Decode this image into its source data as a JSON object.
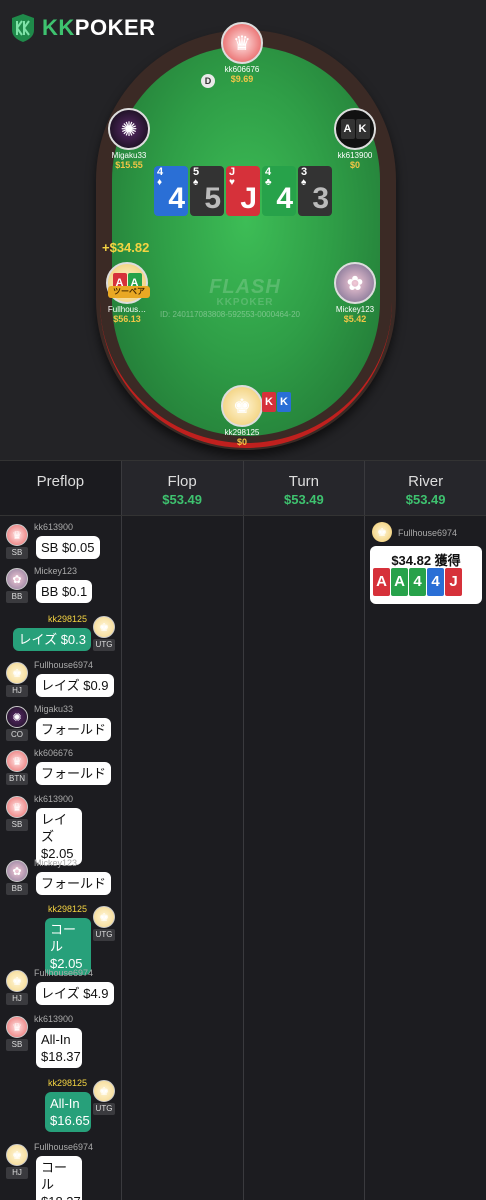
{
  "app": {
    "logo_text": "KKPOKER",
    "logo_kk": "KK",
    "logo_rest": "POKER"
  },
  "colors": {
    "felt": "#2f9e47",
    "accent_green": "#3ec26f",
    "stack_gold": "#f2c646",
    "raise_bubble": "#27a07a"
  },
  "table": {
    "watermark_main": "FLASH",
    "watermark_sub": "KKPOKER",
    "hand_id": "ID: 240117083808-592553-0000464-20",
    "dealer_button": "D",
    "winner_amount": "+$34.82",
    "winner_hand_badge": "ツーペア",
    "players": {
      "top": {
        "name": "kk606676",
        "stack": "$9.69"
      },
      "migaku": {
        "name": "Migaku33",
        "stack": "$15.55"
      },
      "kk613900": {
        "name": "kk613900",
        "stack": "$0"
      },
      "fullhouse": {
        "name": "Fullhous…",
        "stack": "$56.13"
      },
      "mickey": {
        "name": "Mickey123",
        "stack": "$5.42"
      },
      "hero": {
        "name": "kk298125",
        "stack": "$0"
      }
    },
    "board": [
      {
        "rank": "4",
        "suit": "♦",
        "color": "blue"
      },
      {
        "rank": "5",
        "suit": "♠",
        "color": "black"
      },
      {
        "rank": "J",
        "suit": "♥",
        "color": "red"
      },
      {
        "rank": "4",
        "suit": "♣",
        "color": "green"
      },
      {
        "rank": "3",
        "suit": "♠",
        "color": "black"
      }
    ],
    "kk613900_cards": [
      "A",
      "K"
    ],
    "hero_cards": [
      "K",
      "K"
    ],
    "fullhouse_cards": [
      "A",
      "A"
    ]
  },
  "streets": [
    {
      "name": "Preflop",
      "pot": ""
    },
    {
      "name": "Flop",
      "pot": "$53.49"
    },
    {
      "name": "Turn",
      "pot": "$53.49"
    },
    {
      "name": "River",
      "pot": "$53.49"
    }
  ],
  "preflop_actions": [
    {
      "player": "kk613900",
      "pos": "SB",
      "text": "SB $0.05",
      "side": "left"
    },
    {
      "player": "Mickey123",
      "pos": "BB",
      "text": "BB $0.1",
      "side": "left"
    },
    {
      "player": "kk298125",
      "pos": "UTG",
      "text": "レイズ $0.3",
      "side": "right"
    },
    {
      "player": "Fullhouse6974",
      "pos": "HJ",
      "text": "レイズ $0.9",
      "side": "left"
    },
    {
      "player": "Migaku33",
      "pos": "CO",
      "text": "フォールド",
      "side": "left"
    },
    {
      "player": "kk606676",
      "pos": "BTN",
      "text": "フォールド",
      "side": "left"
    },
    {
      "player": "kk613900",
      "pos": "SB",
      "text": "レイズ $2.05",
      "side": "left"
    },
    {
      "player": "Mickey123",
      "pos": "BB",
      "text": "フォールド",
      "side": "left"
    },
    {
      "player": "kk298125",
      "pos": "UTG",
      "text": "コール $2.05",
      "side": "right"
    },
    {
      "player": "Fullhouse6974",
      "pos": "HJ",
      "text": "レイズ $4.9",
      "side": "left"
    },
    {
      "player": "kk613900",
      "pos": "SB",
      "text": "All-In $18.37",
      "side": "left"
    },
    {
      "player": "kk298125",
      "pos": "UTG",
      "text": "All-In $16.65",
      "side": "right"
    },
    {
      "player": "Fullhouse6974",
      "pos": "HJ",
      "text": "コール $18.37",
      "side": "left"
    }
  ],
  "river_result": {
    "player": "Fullhouse6974",
    "text": "$34.82 獲得",
    "cards": [
      {
        "rank": "A",
        "color": "red"
      },
      {
        "rank": "A",
        "color": "green"
      },
      {
        "rank": "4",
        "color": "green"
      },
      {
        "rank": "4",
        "color": "blue"
      },
      {
        "rank": "J",
        "color": "red"
      }
    ]
  }
}
